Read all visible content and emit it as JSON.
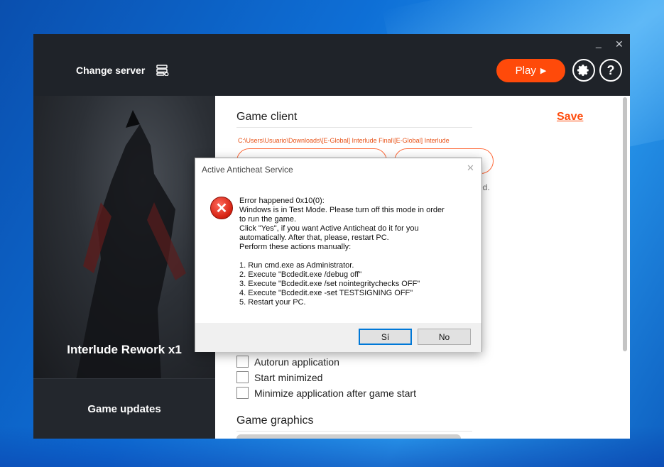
{
  "window_controls": {
    "minimize": "_",
    "close": "✕"
  },
  "header": {
    "change_server_label": "Change server",
    "play_label": "Play",
    "play_icon": "▶",
    "gear_icon": "gear-icon",
    "help_label": "?"
  },
  "left_panel": {
    "server_title": "Interlude Rework x1",
    "game_updates_label": "Game updates"
  },
  "main": {
    "game_client_title": "Game client",
    "save_label": "Save",
    "client_path": "C:\\Users\\Usuario\\Downloads\\[E-Global] Interlude Final\\[E-Global] Interlude",
    "partial_text": "ed.",
    "options": [
      {
        "label": "Autorun application",
        "checked": false
      },
      {
        "label": "Start minimized",
        "checked": false
      },
      {
        "label": "Minimize application after game start",
        "checked": false
      }
    ],
    "game_graphics_title": "Game graphics"
  },
  "dialog": {
    "title": "Active Anticheat Service",
    "icon": "error-icon",
    "message_lines": [
      "Error happened 0x10(0):",
      "Windows is in Test Mode. Please turn off this mode in order",
      "to run the game.",
      "Click \"Yes\", if you want Active Anticheat do it for you",
      "automatically. After that, please, restart PC.",
      "Perform these actions manually:",
      "",
      "1. Run cmd.exe as Administrator.",
      "2. Execute \"Bcdedit.exe /debug off\"",
      "3. Execute \"Bcdedit.exe /set nointegritychecks OFF\"",
      "4. Execute \"Bcdedit.exe -set TESTSIGNING OFF\"",
      "5. Restart your PC."
    ],
    "yes_label": "Sí",
    "no_label": "No"
  },
  "colors": {
    "accent": "#ff4a0a",
    "topbar": "#1f2329",
    "error_red": "#d42010"
  }
}
